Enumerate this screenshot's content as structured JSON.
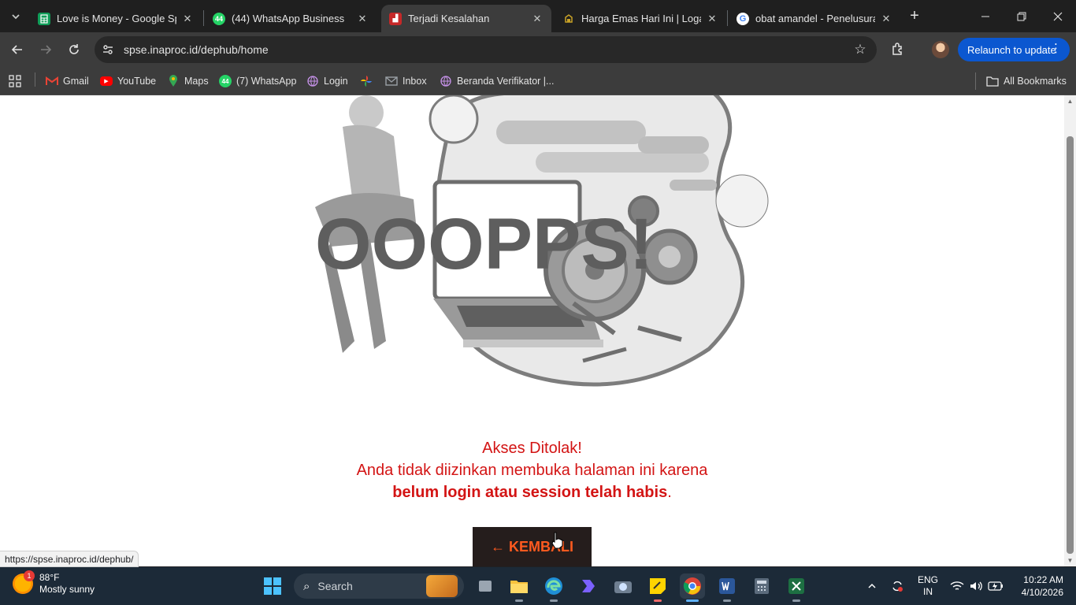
{
  "tabs": [
    {
      "title": "Love is Money - Google Spre",
      "icon": "sheets-icon",
      "color": "#0f9d58"
    },
    {
      "title": "(44) WhatsApp Business",
      "icon": "whatsapp-icon",
      "color": "#25d366",
      "badge": "44"
    },
    {
      "title": "Terjadi Kesalahan",
      "icon": "lkpp-icon",
      "color": "#c62828",
      "active": true
    },
    {
      "title": "Harga Emas Hari Ini | Logam",
      "icon": "gold-icon",
      "color": "#c9a227"
    },
    {
      "title": "obat amandel - Penelusuran",
      "icon": "google-icon",
      "color": "#4285f4"
    }
  ],
  "toolbar": {
    "url": "spse.inaproc.id/dephub/home",
    "relaunch_label": "Relaunch to update"
  },
  "bookmarks": [
    {
      "label": "Gmail",
      "icon": "gmail-icon",
      "color": "#ea4335"
    },
    {
      "label": "YouTube",
      "icon": "youtube-icon",
      "color": "#ff0000"
    },
    {
      "label": "Maps",
      "icon": "maps-icon",
      "color": "#34a853"
    },
    {
      "label": "(7) WhatsApp",
      "icon": "whatsapp-icon",
      "color": "#25d366",
      "badge": "44"
    },
    {
      "label": "Login",
      "icon": "globe-icon",
      "color": "#c792ea"
    },
    {
      "label": "",
      "icon": "pinwheel-icon",
      "color": "#fbbc04"
    },
    {
      "label": "Inbox",
      "icon": "mail-icon",
      "color": "#9aa0a6"
    },
    {
      "label": "Beranda Verifikator |...",
      "icon": "globe-icon",
      "color": "#c792ea"
    }
  ],
  "all_bookmarks_label": "All Bookmarks",
  "page": {
    "illustration_text": "OOOPPS!",
    "line1": "Akses Ditolak!",
    "line2": "Anda tidak diizinkan membuka halaman ini karena",
    "line3_bold": "belum login atau session telah habis",
    "line3_end": ".",
    "button_label": "← KEMBALI",
    "accent_color": "#d31414",
    "button_text_color": "#ff5a1f"
  },
  "status_url": "https://spse.inaproc.id/dephub/",
  "taskbar": {
    "weather_temp": "88°F",
    "weather_desc": "Mostly sunny",
    "weather_badge": "1",
    "search_placeholder": "Search",
    "lang_top": "ENG",
    "lang_bottom": "IN",
    "time": "10:22 AM",
    "date": "4/10/2026"
  }
}
